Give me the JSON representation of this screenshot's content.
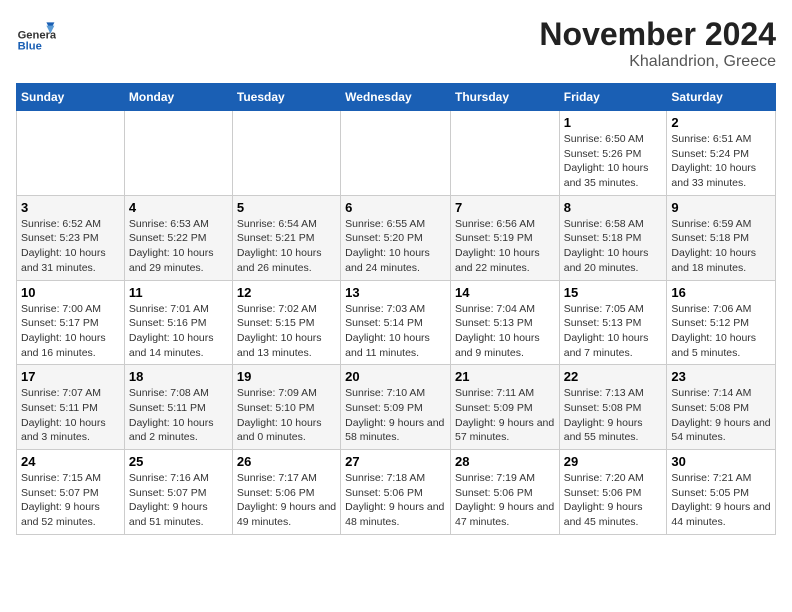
{
  "logo": {
    "general": "General",
    "blue": "Blue"
  },
  "header": {
    "month": "November 2024",
    "location": "Khalandrion, Greece"
  },
  "weekdays": [
    "Sunday",
    "Monday",
    "Tuesday",
    "Wednesday",
    "Thursday",
    "Friday",
    "Saturday"
  ],
  "weeks": [
    [
      {
        "day": "",
        "info": ""
      },
      {
        "day": "",
        "info": ""
      },
      {
        "day": "",
        "info": ""
      },
      {
        "day": "",
        "info": ""
      },
      {
        "day": "",
        "info": ""
      },
      {
        "day": "1",
        "info": "Sunrise: 6:50 AM\nSunset: 5:26 PM\nDaylight: 10 hours and 35 minutes."
      },
      {
        "day": "2",
        "info": "Sunrise: 6:51 AM\nSunset: 5:24 PM\nDaylight: 10 hours and 33 minutes."
      }
    ],
    [
      {
        "day": "3",
        "info": "Sunrise: 6:52 AM\nSunset: 5:23 PM\nDaylight: 10 hours and 31 minutes."
      },
      {
        "day": "4",
        "info": "Sunrise: 6:53 AM\nSunset: 5:22 PM\nDaylight: 10 hours and 29 minutes."
      },
      {
        "day": "5",
        "info": "Sunrise: 6:54 AM\nSunset: 5:21 PM\nDaylight: 10 hours and 26 minutes."
      },
      {
        "day": "6",
        "info": "Sunrise: 6:55 AM\nSunset: 5:20 PM\nDaylight: 10 hours and 24 minutes."
      },
      {
        "day": "7",
        "info": "Sunrise: 6:56 AM\nSunset: 5:19 PM\nDaylight: 10 hours and 22 minutes."
      },
      {
        "day": "8",
        "info": "Sunrise: 6:58 AM\nSunset: 5:18 PM\nDaylight: 10 hours and 20 minutes."
      },
      {
        "day": "9",
        "info": "Sunrise: 6:59 AM\nSunset: 5:18 PM\nDaylight: 10 hours and 18 minutes."
      }
    ],
    [
      {
        "day": "10",
        "info": "Sunrise: 7:00 AM\nSunset: 5:17 PM\nDaylight: 10 hours and 16 minutes."
      },
      {
        "day": "11",
        "info": "Sunrise: 7:01 AM\nSunset: 5:16 PM\nDaylight: 10 hours and 14 minutes."
      },
      {
        "day": "12",
        "info": "Sunrise: 7:02 AM\nSunset: 5:15 PM\nDaylight: 10 hours and 13 minutes."
      },
      {
        "day": "13",
        "info": "Sunrise: 7:03 AM\nSunset: 5:14 PM\nDaylight: 10 hours and 11 minutes."
      },
      {
        "day": "14",
        "info": "Sunrise: 7:04 AM\nSunset: 5:13 PM\nDaylight: 10 hours and 9 minutes."
      },
      {
        "day": "15",
        "info": "Sunrise: 7:05 AM\nSunset: 5:13 PM\nDaylight: 10 hours and 7 minutes."
      },
      {
        "day": "16",
        "info": "Sunrise: 7:06 AM\nSunset: 5:12 PM\nDaylight: 10 hours and 5 minutes."
      }
    ],
    [
      {
        "day": "17",
        "info": "Sunrise: 7:07 AM\nSunset: 5:11 PM\nDaylight: 10 hours and 3 minutes."
      },
      {
        "day": "18",
        "info": "Sunrise: 7:08 AM\nSunset: 5:11 PM\nDaylight: 10 hours and 2 minutes."
      },
      {
        "day": "19",
        "info": "Sunrise: 7:09 AM\nSunset: 5:10 PM\nDaylight: 10 hours and 0 minutes."
      },
      {
        "day": "20",
        "info": "Sunrise: 7:10 AM\nSunset: 5:09 PM\nDaylight: 9 hours and 58 minutes."
      },
      {
        "day": "21",
        "info": "Sunrise: 7:11 AM\nSunset: 5:09 PM\nDaylight: 9 hours and 57 minutes."
      },
      {
        "day": "22",
        "info": "Sunrise: 7:13 AM\nSunset: 5:08 PM\nDaylight: 9 hours and 55 minutes."
      },
      {
        "day": "23",
        "info": "Sunrise: 7:14 AM\nSunset: 5:08 PM\nDaylight: 9 hours and 54 minutes."
      }
    ],
    [
      {
        "day": "24",
        "info": "Sunrise: 7:15 AM\nSunset: 5:07 PM\nDaylight: 9 hours and 52 minutes."
      },
      {
        "day": "25",
        "info": "Sunrise: 7:16 AM\nSunset: 5:07 PM\nDaylight: 9 hours and 51 minutes."
      },
      {
        "day": "26",
        "info": "Sunrise: 7:17 AM\nSunset: 5:06 PM\nDaylight: 9 hours and 49 minutes."
      },
      {
        "day": "27",
        "info": "Sunrise: 7:18 AM\nSunset: 5:06 PM\nDaylight: 9 hours and 48 minutes."
      },
      {
        "day": "28",
        "info": "Sunrise: 7:19 AM\nSunset: 5:06 PM\nDaylight: 9 hours and 47 minutes."
      },
      {
        "day": "29",
        "info": "Sunrise: 7:20 AM\nSunset: 5:06 PM\nDaylight: 9 hours and 45 minutes."
      },
      {
        "day": "30",
        "info": "Sunrise: 7:21 AM\nSunset: 5:05 PM\nDaylight: 9 hours and 44 minutes."
      }
    ]
  ]
}
